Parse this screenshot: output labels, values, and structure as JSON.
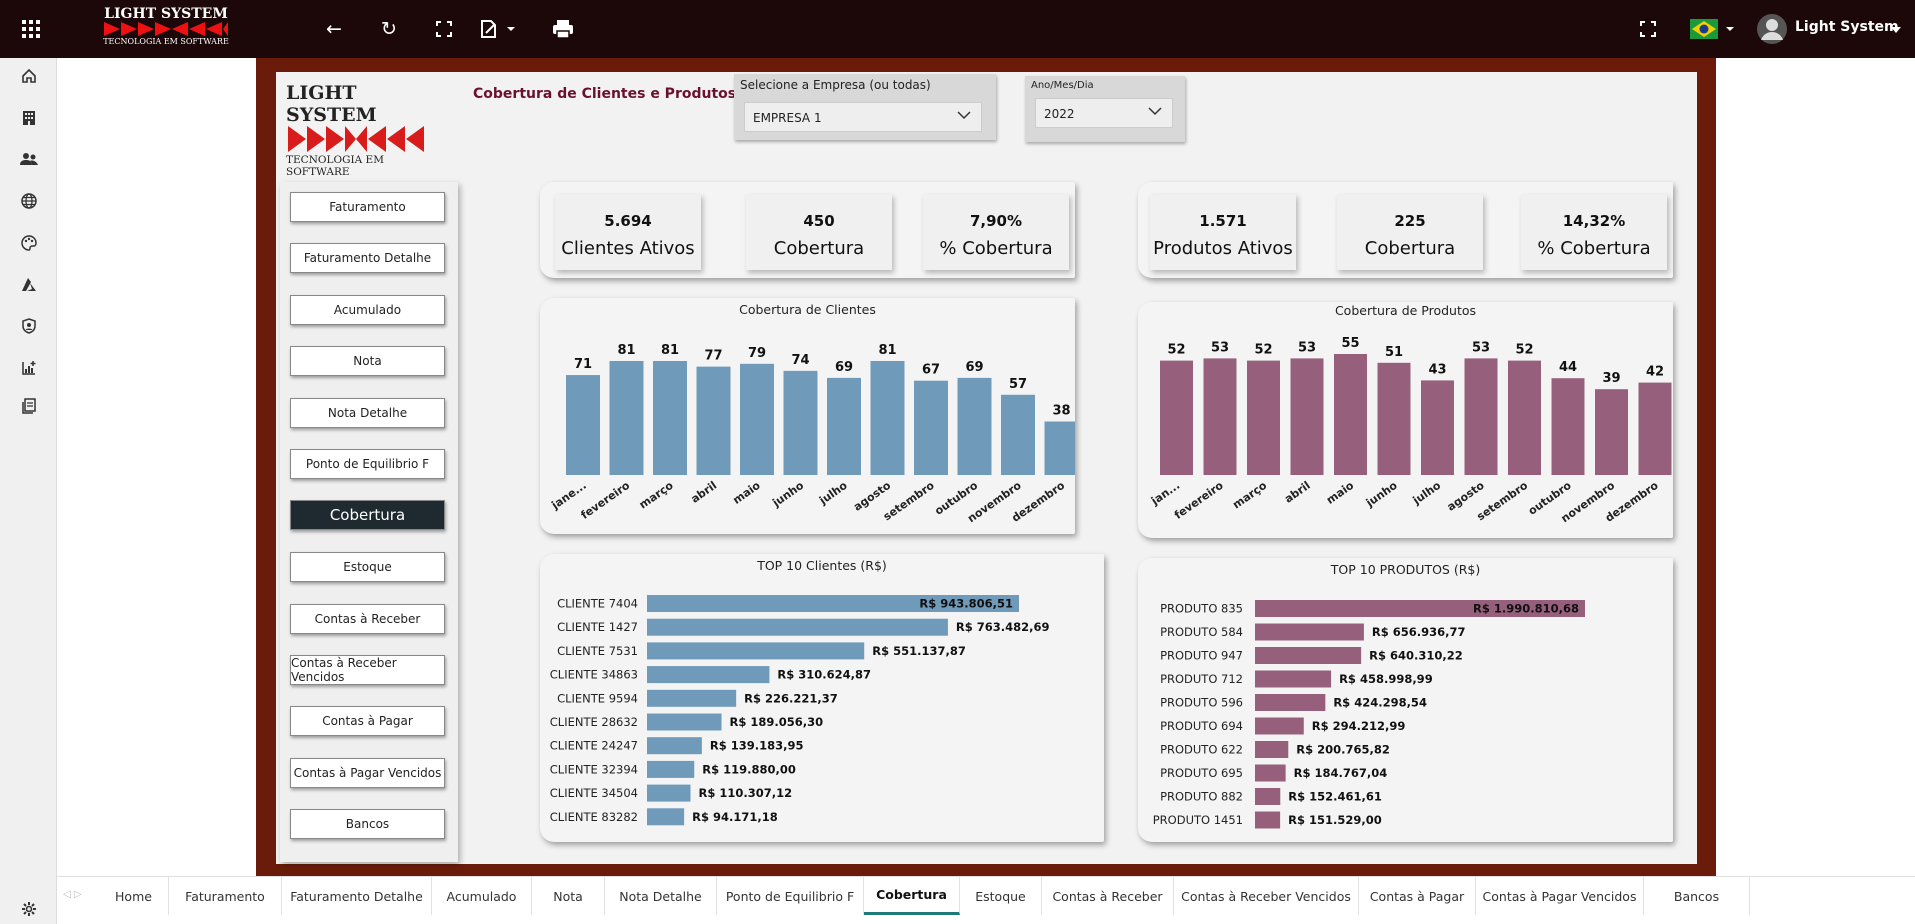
{
  "topbar": {
    "logo_title": "LIGHT SYSTEM",
    "logo_subtitle": "TECNOLOGIA EM SOFTWARE",
    "user_name": "Light System"
  },
  "report": {
    "logo_title": "LIGHT SYSTEM",
    "logo_subtitle": "TECNOLOGIA EM SOFTWARE",
    "title": "Cobertura de Clientes e Produtos",
    "empresa": {
      "label": "Selecione a Empresa (ou todas)",
      "value": "EMPRESA 1"
    },
    "ano": {
      "label": "Ano/Mes/Dia",
      "value": "2022"
    }
  },
  "nav": {
    "items": [
      "Faturamento",
      "Faturamento Detalhe",
      "Acumulado",
      "Nota",
      "Nota Detalhe",
      "Ponto de Equilibrio F",
      "Cobertura",
      "Estoque",
      "Contas à Receber",
      "Contas à Receber Vencidos",
      "Contas à Pagar",
      "Contas à Pagar Vencidos",
      "Bancos"
    ],
    "active": "Cobertura"
  },
  "kpis": {
    "clientes_ativos": {
      "value": "5.694",
      "label": "Clientes Ativos"
    },
    "clientes_cobertura": {
      "value": "450",
      "label": "Cobertura"
    },
    "clientes_pct": {
      "value": "7,90%",
      "label": "% Cobertura"
    },
    "produtos_ativos": {
      "value": "1.571",
      "label": "Produtos Ativos"
    },
    "produtos_cobertura": {
      "value": "225",
      "label": "Cobertura"
    },
    "produtos_pct": {
      "value": "14,32%",
      "label": "% Cobertura"
    }
  },
  "colors": {
    "clientes": "#6f9aba",
    "produtos": "#96607c"
  },
  "chart_data": [
    {
      "type": "bar",
      "title": "Cobertura de Clientes",
      "categories": [
        "jane...",
        "fevereiro",
        "março",
        "abril",
        "maio",
        "junho",
        "julho",
        "agosto",
        "setembro",
        "outubro",
        "novembro",
        "dezembro"
      ],
      "values": [
        71,
        81,
        81,
        77,
        79,
        74,
        69,
        81,
        67,
        69,
        57,
        38
      ]
    },
    {
      "type": "bar",
      "title": "Cobertura de Produtos",
      "categories": [
        "jan...",
        "fevereiro",
        "março",
        "abril",
        "maio",
        "junho",
        "julho",
        "agosto",
        "setembro",
        "outubro",
        "novembro",
        "dezembro"
      ],
      "values": [
        52,
        53,
        52,
        53,
        55,
        51,
        43,
        53,
        52,
        44,
        39,
        42
      ]
    },
    {
      "type": "bar",
      "orientation": "horizontal",
      "title": "TOP 10 Clientes (R$)",
      "categories": [
        "CLIENTE 7404",
        "CLIENTE 1427",
        "CLIENTE 7531",
        "CLIENTE 34863",
        "CLIENTE 9594",
        "CLIENTE 28632",
        "CLIENTE 24247",
        "CLIENTE 32394",
        "CLIENTE 34504",
        "CLIENTE 83282"
      ],
      "values": [
        943806.51,
        763482.69,
        551137.87,
        310624.87,
        226221.37,
        189056.3,
        139183.95,
        119880.0,
        110307.12,
        94171.18
      ],
      "labels": [
        "R$ 943.806,51",
        "R$ 763.482,69",
        "R$ 551.137,87",
        "R$ 310.624,87",
        "R$ 226.221,37",
        "R$ 189.056,30",
        "R$ 139.183,95",
        "R$ 119.880,00",
        "R$ 110.307,12",
        "R$ 94.171,18"
      ]
    },
    {
      "type": "bar",
      "orientation": "horizontal",
      "title": "TOP 10 PRODUTOS (R$)",
      "categories": [
        "PRODUTO 835",
        "PRODUTO 584",
        "PRODUTO 947",
        "PRODUTO 712",
        "PRODUTO 596",
        "PRODUTO 694",
        "PRODUTO 622",
        "PRODUTO 695",
        "PRODUTO 882",
        "PRODUTO 1451"
      ],
      "values": [
        1990810.68,
        656936.77,
        640310.22,
        458998.99,
        424298.54,
        294212.99,
        200765.82,
        184767.04,
        152461.61,
        151529.0
      ],
      "labels": [
        "R$ 1.990.810,68",
        "R$ 656.936,77",
        "R$ 640.310,22",
        "R$ 458.998,99",
        "R$ 424.298,54",
        "R$ 294.212,99",
        "R$ 200.765,82",
        "R$ 184.767,04",
        "R$ 152.461,61",
        "R$ 151.529,00"
      ]
    }
  ],
  "tabs": {
    "items": [
      "Home",
      "Faturamento",
      "Faturamento Detalhe",
      "Acumulado",
      "Nota",
      "Nota Detalhe",
      "Ponto de Equilibrio F",
      "Cobertura",
      "Estoque",
      "Contas à Receber",
      "Contas à Receber Vencidos",
      "Contas à Pagar",
      "Contas à Pagar Vencidos",
      "Bancos"
    ],
    "active": "Cobertura"
  }
}
